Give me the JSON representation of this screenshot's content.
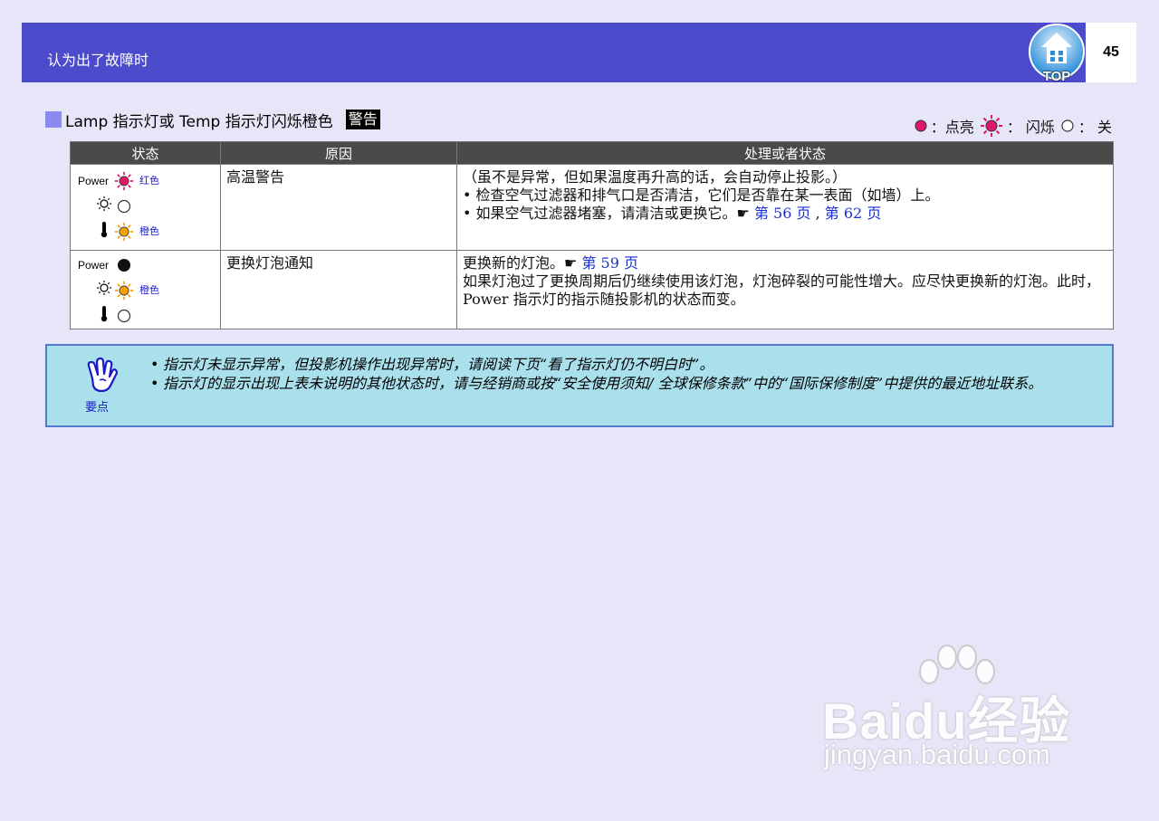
{
  "header": {
    "title": "认为出了故障时",
    "page_number": "45",
    "top_label": "TOP"
  },
  "section": {
    "title": "Lamp 指示灯或 Temp 指示灯闪烁橙色",
    "badge": "警告"
  },
  "legend": {
    "on_label": "：点亮",
    "blink_label": "： 闪烁",
    "off_label": "： 关"
  },
  "table": {
    "headers": [
      "状态",
      "原因",
      "处理或者状态"
    ],
    "rows": [
      {
        "state": {
          "power_label": "Power",
          "power_color": "红色",
          "temp_color": "橙色"
        },
        "cause": "高温警告",
        "action_lines": [
          "（虽不是异常，但如果温度再升高的话，会自动停止投影。）",
          "• 检查空气过滤器和排气口是否清洁，它们是否靠在某一表面（如墙）上。"
        ],
        "action_ref_prefix": "• 如果空气过滤器堵塞，请清洁或更换它。",
        "action_ref_1": "第 56 页",
        "action_ref_sep": " , ",
        "action_ref_2": "第 62 页"
      },
      {
        "state": {
          "power_label": "Power",
          "lamp_color": "橙色"
        },
        "cause": "更换灯泡通知",
        "action_ref_prefix": "更换新的灯泡。",
        "action_ref_1": "第 59 页",
        "action_lines": [
          "如果灯泡过了更换周期后仍继续使用该灯泡，灯泡碎裂的可能性增大。应尽快更换新的灯泡。此时，Power 指示灯的指示随投影机的状态而变。"
        ]
      }
    ]
  },
  "tip": {
    "label": "要点",
    "lines": [
      "指示灯未显示异常，但投影机操作出现异常时，请阅读下页“看了指示灯仍不明白时”。",
      "指示灯的显示出现上表未说明的其他状态时，请与经销商或按“安全使用须知/ 全球保修条款”中的“国际保修制度”中提供的最近地址联系。"
    ]
  },
  "watermark": {
    "main": "Baidu经验",
    "sub": "jingyan.baidu.com"
  },
  "colors": {
    "header_bg": "#4b4bcc",
    "red_led": "#e0186a",
    "orange_led": "#f5a300",
    "link": "#1a2fd0",
    "tip_bg": "#aae0ec"
  }
}
